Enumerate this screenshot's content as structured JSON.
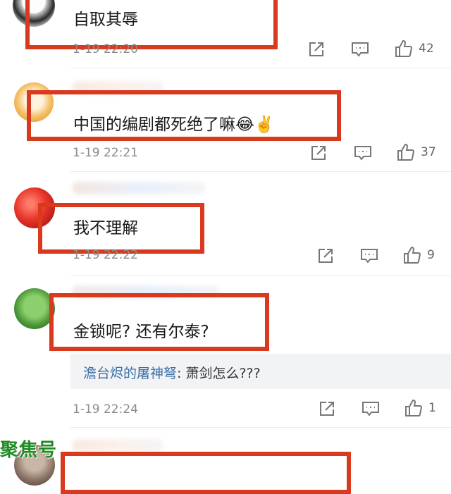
{
  "comments": [
    {
      "text": "自取其辱",
      "time": "1-19 22:20",
      "likes": "42"
    },
    {
      "text": "中国的编剧都死绝了嘛😂✌️",
      "time": "1-19 22:21",
      "likes": "37"
    },
    {
      "text": "我不理解",
      "time": "1-19 22:22",
      "likes": "9"
    },
    {
      "text": "金锁呢? 还有尔泰?",
      "time": "1-19 22:24",
      "likes": "1",
      "reply": {
        "user": "澹台烬的屠神弩",
        "separator": ": ",
        "text": "萧剑怎么???"
      }
    }
  ],
  "watermark": "聚焦号",
  "colors": {
    "highlight": "#d9391d",
    "reply_user": "#3b6fa8",
    "watermark": "#1f8b23"
  },
  "icons": [
    "share-icon",
    "comment-icon",
    "like-icon"
  ]
}
